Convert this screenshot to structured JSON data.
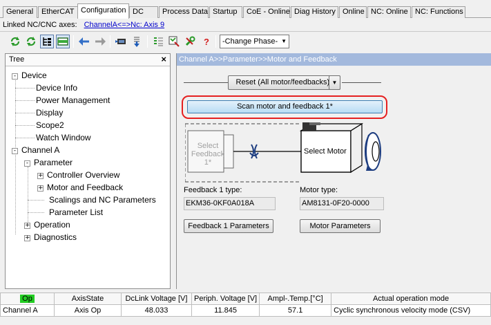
{
  "tabs": [
    {
      "label": "General",
      "active": false
    },
    {
      "label": "EtherCAT",
      "active": false
    },
    {
      "label": "Configuration",
      "active": true
    },
    {
      "label": "DC",
      "active": false
    },
    {
      "label": "Process Data",
      "active": false
    },
    {
      "label": "Startup",
      "active": false
    },
    {
      "label": "CoE - Online",
      "active": false
    },
    {
      "label": "Diag History",
      "active": false
    },
    {
      "label": "Online",
      "active": false
    },
    {
      "label": "NC: Online",
      "active": false
    },
    {
      "label": "NC: Functions",
      "active": false
    }
  ],
  "linked": {
    "label": "Linked NC/CNC axes:",
    "link": "ChannelA<=>Nc: Axis 9"
  },
  "toolbar": {
    "icons": [
      "reload-icon",
      "reload-icon",
      "tree-view-icon",
      "panel-view-icon",
      "arrow-left-icon",
      "arrow-right-icon",
      "download-icon",
      "upload-icon",
      "parameter-list-icon",
      "scan-icon",
      "tools-icon",
      "help-icon"
    ],
    "phase_select": "-Change Phase-"
  },
  "tree": {
    "title": "Tree",
    "nodes": [
      {
        "label": "Device",
        "level": 0,
        "exp": "-"
      },
      {
        "label": "Device Info",
        "level": 1,
        "exp": ""
      },
      {
        "label": "Power Management",
        "level": 1,
        "exp": ""
      },
      {
        "label": "Display",
        "level": 1,
        "exp": ""
      },
      {
        "label": "Scope2",
        "level": 1,
        "exp": ""
      },
      {
        "label": "Watch Window",
        "level": 1,
        "exp": ""
      },
      {
        "label": "Channel A",
        "level": 0,
        "exp": "-"
      },
      {
        "label": "Parameter",
        "level": 1,
        "exp": "-"
      },
      {
        "label": "Controller Overview",
        "level": 2,
        "exp": "+"
      },
      {
        "label": "Motor and Feedback",
        "level": 2,
        "exp": "+"
      },
      {
        "label": "Scalings and NC Parameters",
        "level": 2,
        "exp": ""
      },
      {
        "label": "Parameter List",
        "level": 2,
        "exp": ""
      },
      {
        "label": "Operation",
        "level": 1,
        "exp": "+"
      },
      {
        "label": "Diagnostics",
        "level": 1,
        "exp": "+"
      }
    ]
  },
  "content": {
    "header": "Channel A>>Parameter>>Motor and Feedback",
    "reset_button": "Reset (All motor/feedbacks)*",
    "scan_button": "Scan motor and feedback 1*",
    "select_feedback": "Select Feedback 1*",
    "select_motor": "Select Motor",
    "feedback_type_label": "Feedback 1 type:",
    "feedback_type_value": "EKM36-0KF0A018A",
    "motor_type_label": "Motor type:",
    "motor_type_value": "AM8131-0F20-0000",
    "feedback_params_button": "Feedback 1 Parameters",
    "motor_params_button": "Motor Parameters"
  },
  "status_table": {
    "headers": [
      "Op",
      "AxisState",
      "DcLink Voltage [V]",
      "Periph. Voltage [V]",
      "Ampl-.Temp.[°C]",
      "Actual operation mode"
    ],
    "row": [
      "Channel A",
      "Axis Op",
      "48.033",
      "11.845",
      "57.1",
      "Cyclic synchronous velocity mode (CSV)"
    ],
    "op_color": "#22cc22"
  }
}
